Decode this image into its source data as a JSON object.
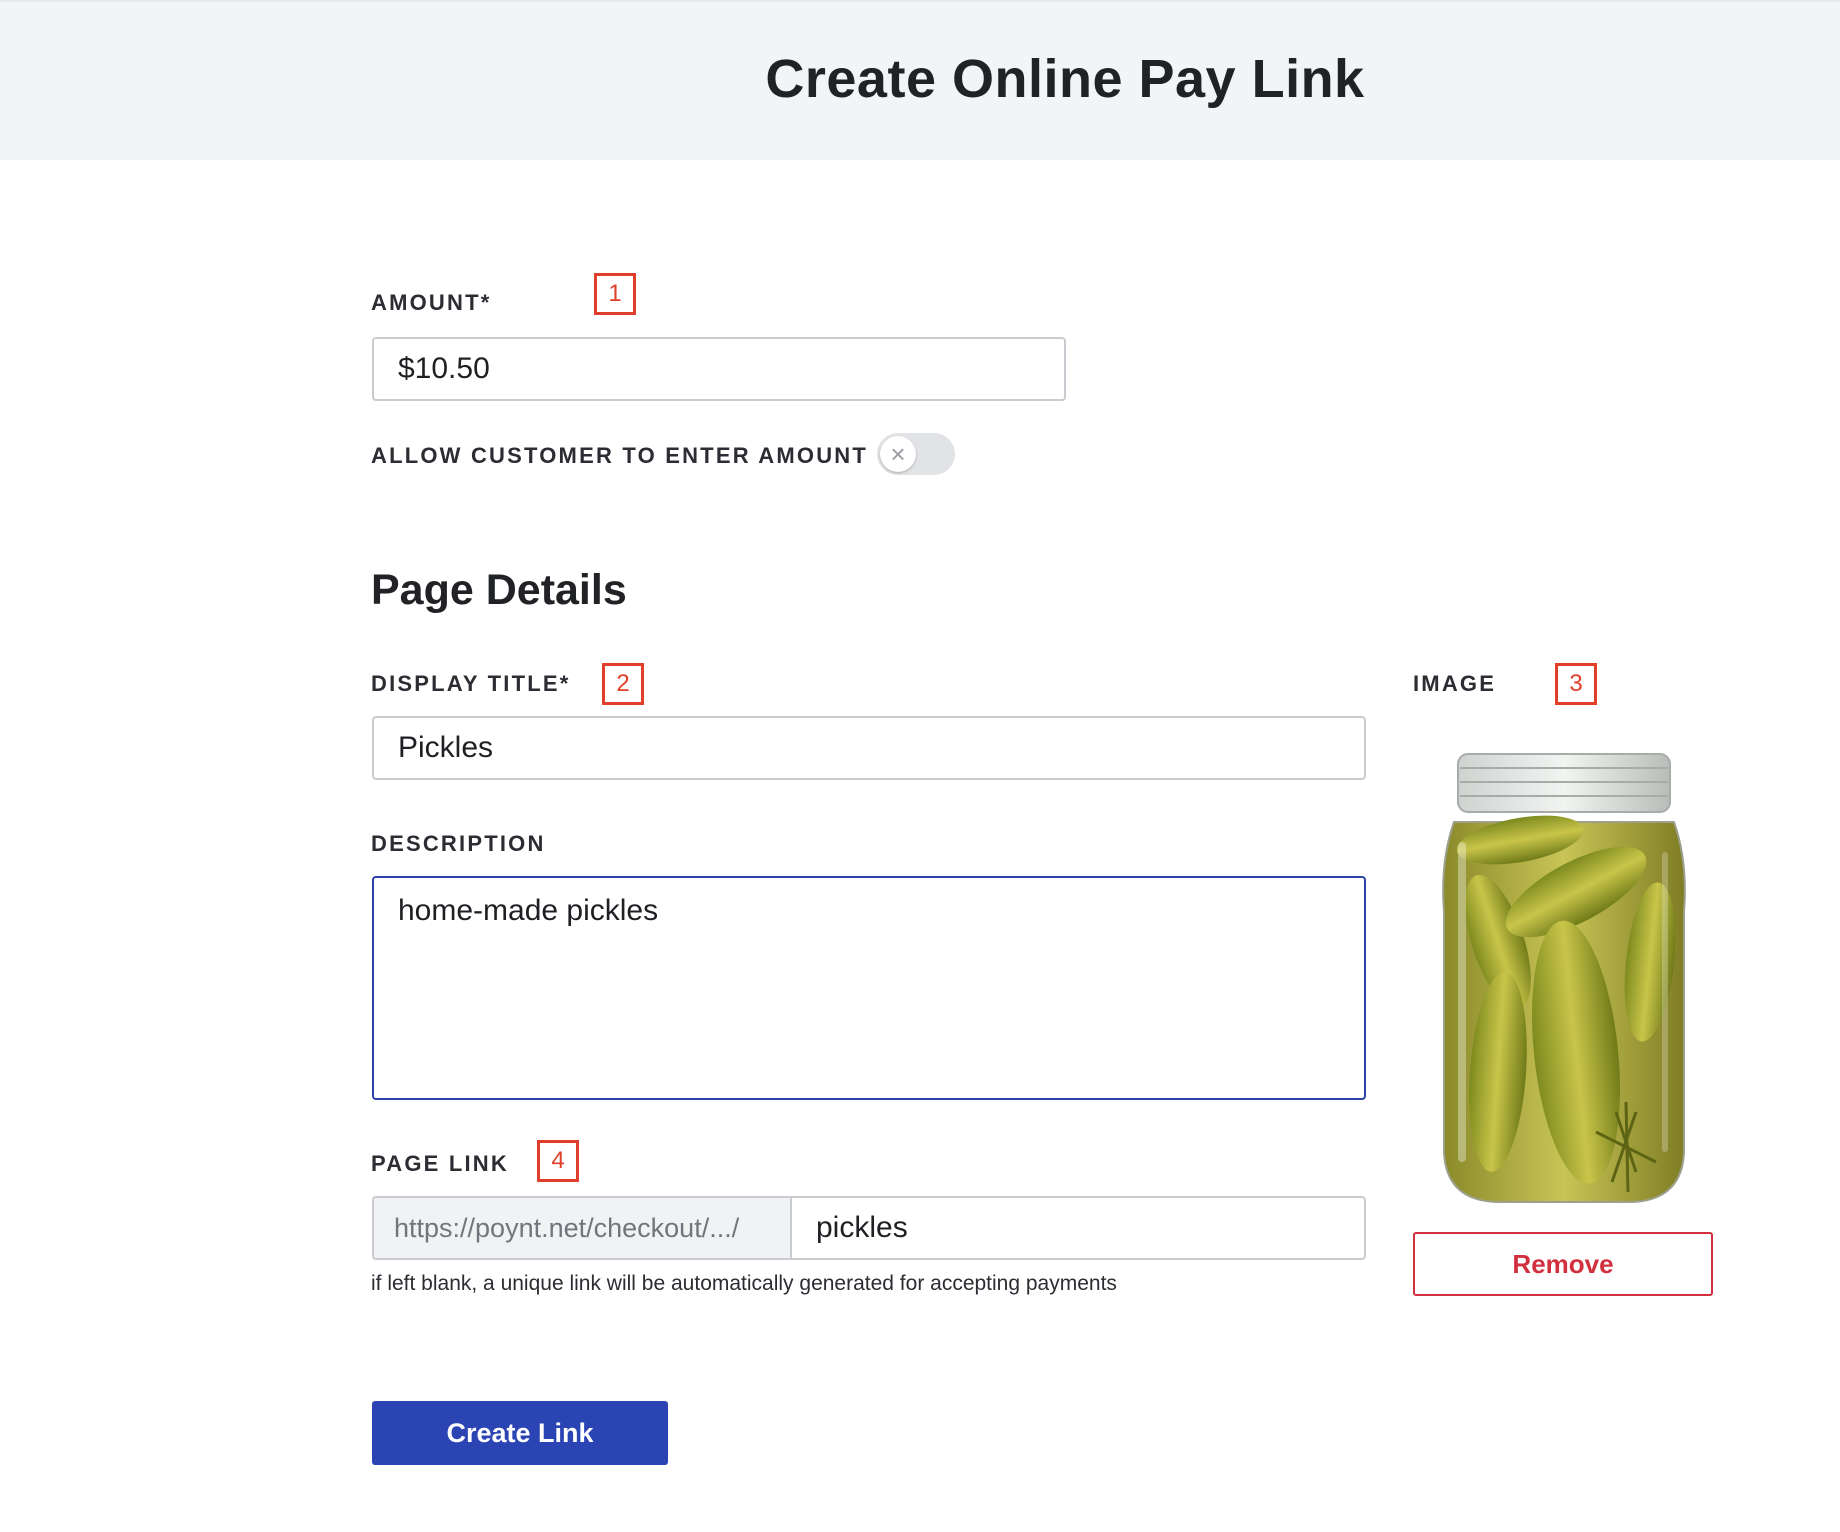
{
  "header": {
    "title": "Create Online Pay Link"
  },
  "amount": {
    "label": "AMOUNT*",
    "value": "$10.50",
    "marker": "1"
  },
  "allow_custom_amount": {
    "label": "ALLOW CUSTOMER TO ENTER AMOUNT",
    "enabled": false,
    "knob_glyph": "×"
  },
  "page_details": {
    "title": "Page Details",
    "display_title": {
      "label": "DISPLAY TITLE*",
      "value": "Pickles",
      "marker": "2"
    },
    "description": {
      "label": "DESCRIPTION",
      "value": "home-made pickles"
    },
    "page_link": {
      "label": "PAGE LINK",
      "marker": "4",
      "prefix": "https://poynt.net/checkout/.../",
      "value": "pickles",
      "helper": "if left blank, a unique link will be automatically generated for accepting payments"
    },
    "image": {
      "label": "IMAGE",
      "marker": "3",
      "icon": "pickle-jar-image",
      "remove_label": "Remove"
    }
  },
  "actions": {
    "create_label": "Create Link"
  },
  "colors": {
    "primary": "#2a44b3",
    "danger": "#d2303f",
    "marker": "#e0402a",
    "header_bg": "#f3f4f7"
  }
}
